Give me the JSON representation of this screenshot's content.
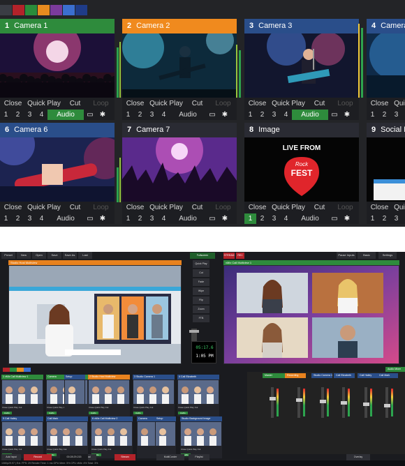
{
  "swatch_colors": [
    "#3a3d44",
    "#b3232a",
    "#2a8c3b",
    "#e78b1f",
    "#7b3b9c",
    "#3b6fd0",
    "#1f3c88"
  ],
  "tiles": [
    {
      "num": "1",
      "name": "Camera 1",
      "hdr_color": "#2e8b3c",
      "scene": "concert-a"
    },
    {
      "num": "2",
      "name": "Camera 2",
      "hdr_color": "#f08a1e",
      "scene": "guitarist-a"
    },
    {
      "num": "3",
      "name": "Camera 3",
      "hdr_color": "#2a4e8a",
      "scene": "guitarist-b"
    },
    {
      "num": "4",
      "name": "Camera",
      "hdr_color": "#2a4e8a",
      "scene": "concert-b"
    },
    {
      "num": "6",
      "name": "Camera 6",
      "hdr_color": "#2a4e8a",
      "scene": "guitarist-c"
    },
    {
      "num": "7",
      "name": "Camera 7",
      "hdr_color": "#2a2b33",
      "scene": "crowd"
    },
    {
      "num": "8",
      "name": "Image",
      "hdr_color": "#2a2b33",
      "scene": "livefest"
    },
    {
      "num": "9",
      "name": "Social M",
      "hdr_color": "#2a2b33",
      "scene": "social"
    }
  ],
  "tile_labels": {
    "close": "Close",
    "quick_play": "Quick Play",
    "cut": "Cut",
    "loop": "Loop",
    "audio": "Audio",
    "n1": "1",
    "n2": "2",
    "n3": "3",
    "n4": "4"
  },
  "livefest": {
    "live_from": "LIVE FROM",
    "rock": "Rock",
    "fest": "FEST"
  },
  "vmix": {
    "tabs": [
      "Preset",
      "New",
      "Open",
      "Save",
      "Save As",
      "Last"
    ],
    "preview_title": "Studio Host Multiview",
    "output_title": "vMix Call Multiview 1",
    "transitions": [
      "Quick Play",
      "Cut",
      "Fade",
      "Wipe",
      "Flip",
      "Zoom",
      "FTB"
    ],
    "fullscreen": "Fullscreen",
    "right_tabs": [
      "Pause Inputs",
      "Basic",
      "Settings"
    ],
    "stream_badge": "STREAM",
    "rec_badge": "REC",
    "clock_time": "05:17.6",
    "clock_time2": "1:05 PM",
    "inputs": [
      {
        "num": "1",
        "name": "vMix Call Multiview 1"
      },
      {
        "num": "",
        "name": "Camera"
      },
      {
        "num": "",
        "name": "Setup"
      },
      {
        "num": "2",
        "name": "Studio Host Multiview"
      },
      {
        "num": "3",
        "name": "Studio Camera 1"
      },
      {
        "num": "4",
        "name": "Call Elizabeth"
      },
      {
        "num": "5",
        "name": "Call Hailey"
      },
      {
        "num": "",
        "name": "Call Mark"
      },
      {
        "num": "6",
        "name": "vMix Call Multiview 2"
      },
      {
        "num": "",
        "name": "Camera"
      },
      {
        "num": "",
        "name": "Setup"
      },
      {
        "num": "",
        "name": "Studio Background Image"
      }
    ],
    "mini_labels": {
      "close": "Close",
      "quick_play": "Quick Play",
      "cut": "Cut",
      "audio": "Audio"
    },
    "mixer_labels": [
      "Master",
      "Recording",
      "Studio Camera 1",
      "Call Elizabeth",
      "Call Hailey",
      "Call Mark",
      "Audio Mixer"
    ],
    "bottom_buttons": [
      "Add Input",
      "Record",
      "External",
      "Stream",
      "MultiCorder",
      "Playlist",
      "Overlay"
    ],
    "status_text": "1080p29.97  |  Ext. FPS: 29  Render Time: 1 ms  GPU Mem: 5%  CPU vMix: 4%  Total: 3%",
    "status_time": "00:28:29.215"
  }
}
